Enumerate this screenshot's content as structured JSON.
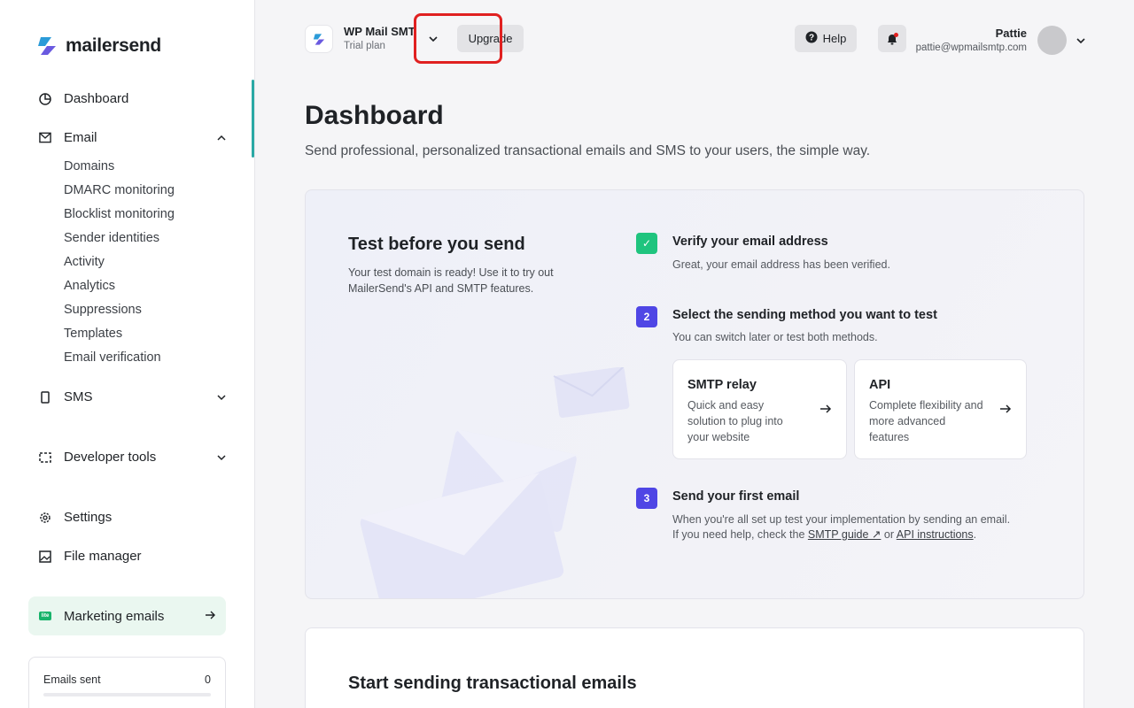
{
  "sidebar": {
    "brand": "mailersend",
    "items": {
      "dashboard": "Dashboard",
      "email": "Email",
      "sms": "SMS",
      "developer_tools": "Developer tools",
      "settings": "Settings",
      "file_manager": "File manager"
    },
    "email_sub": [
      "Domains",
      "DMARC monitoring",
      "Blocklist monitoring",
      "Sender identities",
      "Activity",
      "Analytics",
      "Suppressions",
      "Templates",
      "Email verification"
    ],
    "marketing": {
      "label": "Marketing emails",
      "badge": "lite"
    },
    "usage": {
      "label": "Emails sent",
      "value": "0",
      "fill": 0
    }
  },
  "header": {
    "account_name": "WP Mail SMTP",
    "plan": "Trial plan",
    "upgrade": "Upgrade",
    "help": "Help",
    "user_name": "Pattie",
    "user_email": "pattie@wpmailsmtp.com"
  },
  "main": {
    "title": "Dashboard",
    "subtitle": "Send professional, personalized transactional emails and SMS to your users, the simple way.",
    "test_card": {
      "title": "Test before you send",
      "desc": "Your test domain is ready! Use it to try out MailerSend's API and SMTP features.",
      "steps": [
        {
          "badge": "✓",
          "title": "Verify your email address",
          "text": "Great, your email address has been verified."
        },
        {
          "badge": "2",
          "title": "Select the sending method you want to test",
          "text": "You can switch later or test both methods."
        },
        {
          "badge": "3",
          "title": "Send your first email",
          "text1": "When you're all set up test your implementation by sending an email.",
          "text2_pre": "If you need help, check the ",
          "smtp_link": "SMTP guide ↗",
          "or": " or ",
          "api_link": "API instructions",
          "end": "."
        }
      ],
      "methods": [
        {
          "title": "SMTP relay",
          "desc": "Quick and easy solution to plug into your website"
        },
        {
          "title": "API",
          "desc": "Complete flexibility and more advanced features"
        }
      ]
    },
    "send_card_title": "Start sending transactional emails"
  },
  "colors": {
    "accent_teal": "#2aa9a5",
    "step_purple": "#4f46e5",
    "step_green": "#1fc47e",
    "highlight_red": "#e02020"
  }
}
